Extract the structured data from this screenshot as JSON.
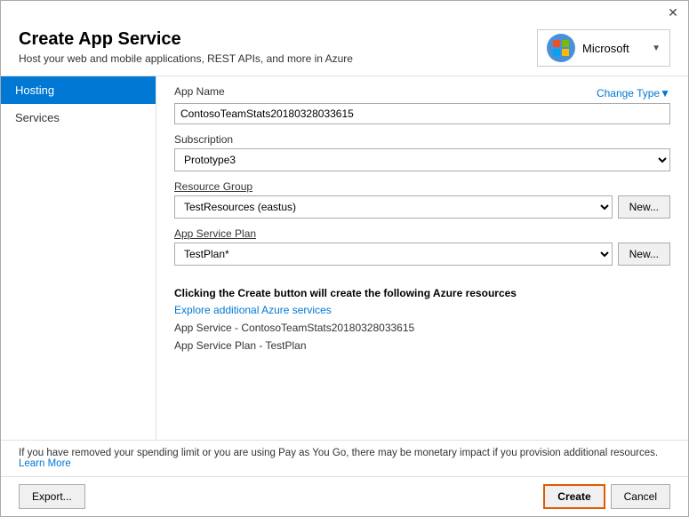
{
  "dialog": {
    "title": "Create App Service",
    "subtitle": "Host your web and mobile applications, REST APIs, and more in Azure"
  },
  "account": {
    "name": "Microsoft",
    "icon": "👤"
  },
  "sidebar": {
    "items": [
      {
        "label": "Hosting",
        "active": true
      },
      {
        "label": "Services",
        "active": false
      }
    ]
  },
  "form": {
    "app_name_label": "App Name",
    "change_type_label": "Change Type",
    "change_type_arrow": "▼",
    "app_name_value": "ContosoTeamStats20180328033615",
    "subscription_label": "Subscription",
    "subscription_value": "Prototype3",
    "resource_group_label": "Resource Group",
    "resource_group_underline": true,
    "resource_group_value": "TestResources (eastus)",
    "resource_group_new_btn": "New...",
    "app_service_plan_label": "App Service Plan",
    "app_service_plan_underline": true,
    "app_service_plan_value": "TestPlan*",
    "app_service_plan_new_btn": "New..."
  },
  "info": {
    "heading": "Clicking the Create button will create the following Azure resources",
    "link": "Explore additional Azure services",
    "items": [
      "App Service - ContosoTeamStats20180328033615",
      "App Service Plan - TestPlan"
    ]
  },
  "footer": {
    "warning_text": "If you have removed your spending limit or you are using Pay as You Go, there may be monetary impact if you provision additional resources.",
    "learn_more_label": "Learn More"
  },
  "buttons": {
    "export_label": "Export...",
    "create_label": "Create",
    "cancel_label": "Cancel"
  }
}
